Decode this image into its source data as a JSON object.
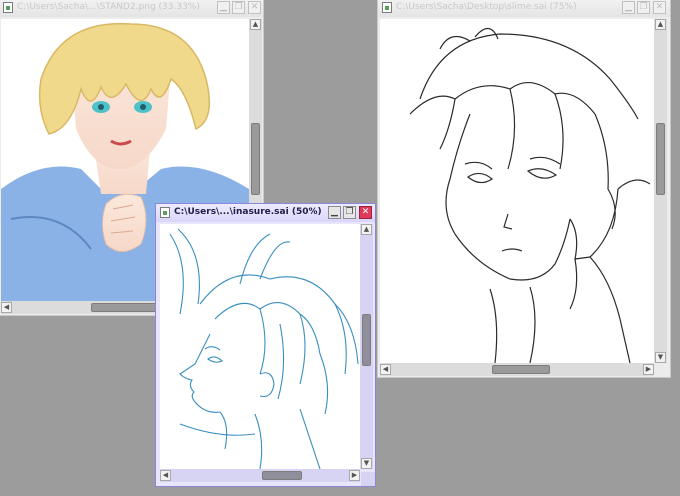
{
  "windows": [
    {
      "id": "stand2",
      "title": "C:\\Users\\Sacha\\...\\STAND2.png (33.33%)",
      "active": false,
      "icons": {
        "minimize": "minimize-icon",
        "maximize": "maximize-icon",
        "close": "close-icon"
      },
      "buttons": {
        "minimize": "▁",
        "maximize": "❐",
        "close": "✕"
      }
    },
    {
      "id": "slime",
      "title": "C:\\Users\\Sacha\\Desktop\\slime.sai (75%)",
      "active": false,
      "icons": {
        "minimize": "minimize-icon",
        "maximize": "maximize-icon",
        "close": "close-icon"
      },
      "buttons": {
        "minimize": "▁",
        "maximize": "❐",
        "close": "✕"
      }
    },
    {
      "id": "inasure",
      "title": "C:\\Users\\...\\inasure.sai (50%)",
      "active": true,
      "icons": {
        "minimize": "minimize-icon",
        "maximize": "maximize-icon",
        "close": "close-icon"
      },
      "buttons": {
        "minimize": "▁",
        "maximize": "❐",
        "close": "✕"
      }
    }
  ],
  "scroll_arrows": {
    "up": "▲",
    "down": "▼",
    "left": "◀",
    "right": "▶"
  },
  "colors": {
    "desktop": "#9c9c9c",
    "active_frame": "#8a86d9",
    "active_close": "#e03a5a",
    "sketch_line": "#3a8fbf",
    "lineart": "#2b2b2b",
    "shirt": "#7fa8e0",
    "hair": "#f1d98c"
  }
}
